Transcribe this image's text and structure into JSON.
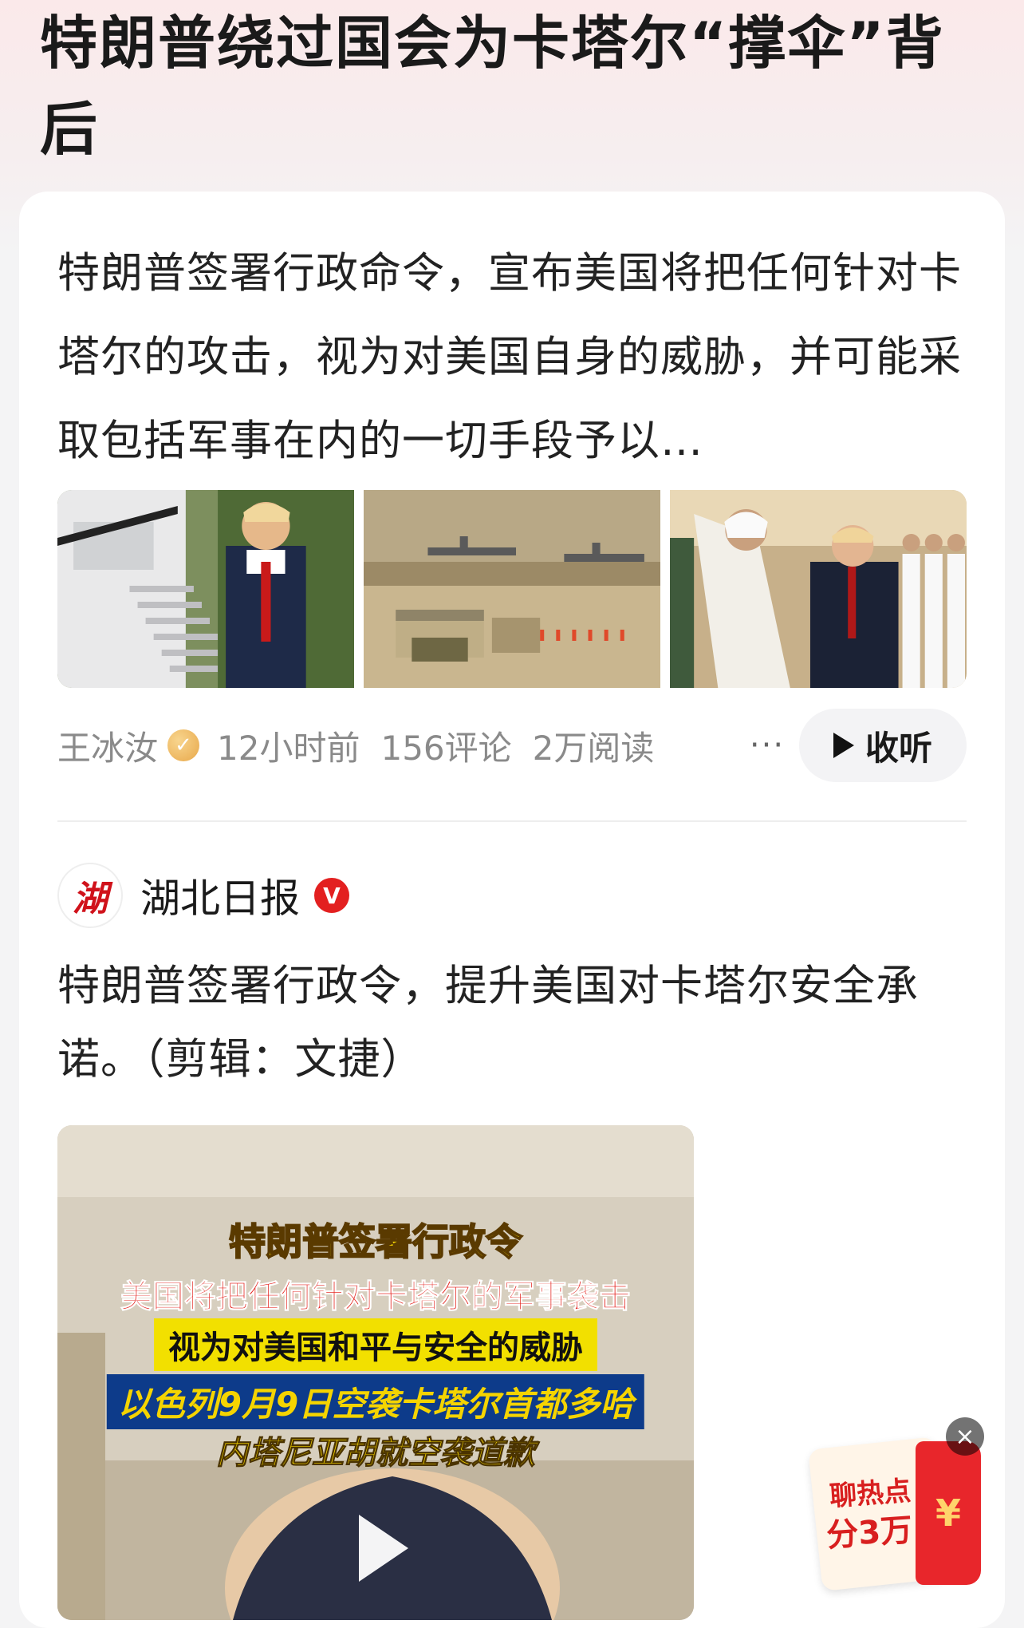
{
  "article": {
    "title": "特朗普绕过国会为卡塔尔“撑伞”背后",
    "summary": "特朗普签署行政命令，宣布美国将把任何针对卡塔尔的攻击，视为对美国自身的威胁，并可能采取包括军事在内的一切手段予以…"
  },
  "meta": {
    "author": "王冰汝",
    "time": "12小时前",
    "comments": "156评论",
    "reads": "2万阅读",
    "more": "···",
    "listen_label": "收听"
  },
  "post": {
    "source_logo_char": "湖",
    "source_name": "湖北日报",
    "verified_mark": "V",
    "text": "特朗普签署行政令，提升美国对卡塔尔安全承诺。（剪辑：文捷）"
  },
  "video": {
    "captions": [
      "特朗普签署行政令",
      "美国将把任何针对卡塔尔的军事袭击",
      "视为对美国和平与安全的威胁",
      "以色列9月9日空袭卡塔尔首都多哈",
      "内塔尼亚胡就空袭道歉"
    ]
  },
  "promo": {
    "line1": "聊热点",
    "line2": "分3万",
    "currency": "¥",
    "close": "×"
  },
  "colors": {
    "accent_red": "#e32020",
    "meta_gray": "#8a8a8a"
  }
}
